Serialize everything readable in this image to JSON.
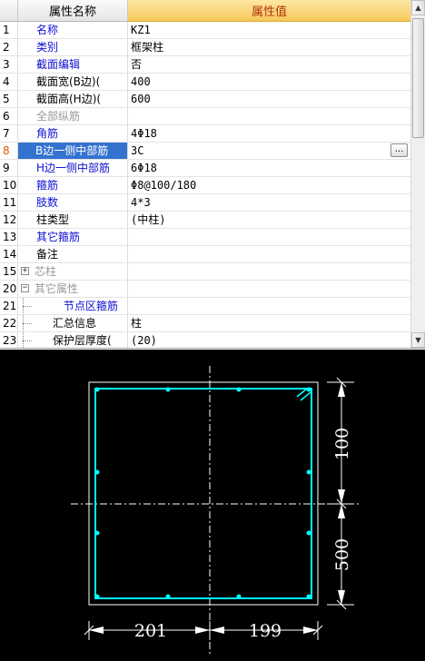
{
  "grid": {
    "header": {
      "name": "属性名称",
      "value": "属性值"
    },
    "rows": [
      {
        "num": "1",
        "name": "名称",
        "value": "KZ1",
        "color": "blue"
      },
      {
        "num": "2",
        "name": "类别",
        "value": "框架柱",
        "color": "blue"
      },
      {
        "num": "3",
        "name": "截面编辑",
        "value": "否",
        "color": "blue"
      },
      {
        "num": "4",
        "name": "截面宽(B边)(",
        "value": "400",
        "color": "black"
      },
      {
        "num": "5",
        "name": "截面高(H边)(",
        "value": "600",
        "color": "black"
      },
      {
        "num": "6",
        "name": "全部纵筋",
        "value": "",
        "color": "grey"
      },
      {
        "num": "7",
        "name": "角筋",
        "value": "4Φ18",
        "color": "blue"
      },
      {
        "num": "8",
        "name": "B边一侧中部筋",
        "value": "3C",
        "color": "blue",
        "selected": true,
        "button": "..."
      },
      {
        "num": "9",
        "name": "H边一侧中部筋",
        "value": "6Φ18",
        "color": "blue"
      },
      {
        "num": "10",
        "name": "箍筋",
        "value": "Φ8@100/180",
        "color": "blue"
      },
      {
        "num": "11",
        "name": "肢数",
        "value": "4*3",
        "color": "blue"
      },
      {
        "num": "12",
        "name": "柱类型",
        "value": "(中柱)",
        "color": "black"
      },
      {
        "num": "13",
        "name": "其它箍筋",
        "value": "",
        "color": "blue"
      },
      {
        "num": "14",
        "name": "备注",
        "value": "",
        "color": "black"
      },
      {
        "num": "15",
        "name": "芯柱",
        "value": "",
        "color": "grey",
        "expander": "+"
      },
      {
        "num": "20",
        "name": "其它属性",
        "value": "",
        "color": "grey",
        "expander": "−"
      },
      {
        "num": "21",
        "name": "节点区箍筋",
        "value": "",
        "color": "blue",
        "child": true
      },
      {
        "num": "22",
        "name": "汇总信息",
        "value": "柱",
        "color": "black",
        "child": true
      },
      {
        "num": "23",
        "name": "保护层厚度(",
        "value": "(20)",
        "color": "black",
        "child": true
      }
    ]
  },
  "scrollbar": {
    "up_icon": "arrow-up-icon",
    "down_icon": "arrow-down-icon"
  },
  "drawing": {
    "dim_right_top": "100",
    "dim_right_bottom": "500",
    "dim_bottom_left": "201",
    "dim_bottom_right": "199",
    "colors": {
      "rebar": "#00ffff",
      "outline": "#ffffff",
      "background": "#000000"
    }
  }
}
